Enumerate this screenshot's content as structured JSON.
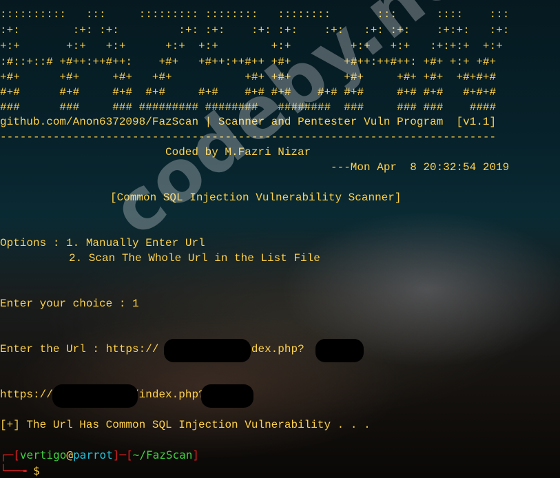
{
  "terminal": {
    "banner": [
      "::::::::::   :::     ::::::::: ::::::::   ::::::::       :::      ::::    :::",
      ":+:        :+: :+:         :+: :+:    :+: :+:    :+:   :+: :+:    :+:+:   :+:",
      "+:+       +:+   +:+      +:+  +:+        +:+         +:+   +:+   :+:+:+  +:+",
      ":#::+::# +#++:++#++:    +#+   +#++:++#++ +#+        +#++:++#++: +#+ +:+ +#+",
      "+#+      +#+     +#+   +#+           +#+ +#+        +#+     +#+ +#+  +#+#+#",
      "#+#      #+#     #+#  #+#     #+#    #+# #+#    #+# #+#     #+# #+#   #+#+#",
      "###      ###     ### ######### ########   ########  ###     ### ###    ####"
    ],
    "github_line": "github.com/Anon6372098/FazScan | Scanner and Pentester Vuln Program  [v1.1]",
    "separator": "---------------------------------------------------------------------------",
    "coded_by": "Coded by M.Fazri Nizar",
    "date_line": "---Mon Apr  8 20:32:54 2019",
    "scanner_title": "[Common SQL Injection Vulnerability Scanner]",
    "options_line1": "Options : 1. Manually Enter Url",
    "options_line2": "2. Scan The Whole Url in the List File",
    "choice_line": "Enter your choice : 1",
    "enter_url_line": "Enter the Url : https://            index.php?",
    "scanned_url_line": "https://            /index.php?",
    "result_line": "[+] The Url Has Common SQL Injection Vulnerability . . .",
    "prompt": {
      "bracket_open": "┌─[",
      "user": "vertigo",
      "at": "@",
      "host": "parrot",
      "sep": "]─[",
      "path": "~/FazScan",
      "bracket_close": "]",
      "second_line_prefix": "└──╼ ",
      "symbol": "$"
    }
  },
  "watermark": "codeby.net",
  "colors": {
    "terminal_text": "#ffd24a",
    "prompt_red": "#e02020",
    "prompt_green": "#40d040",
    "prompt_cyan": "#2bbfd6"
  }
}
